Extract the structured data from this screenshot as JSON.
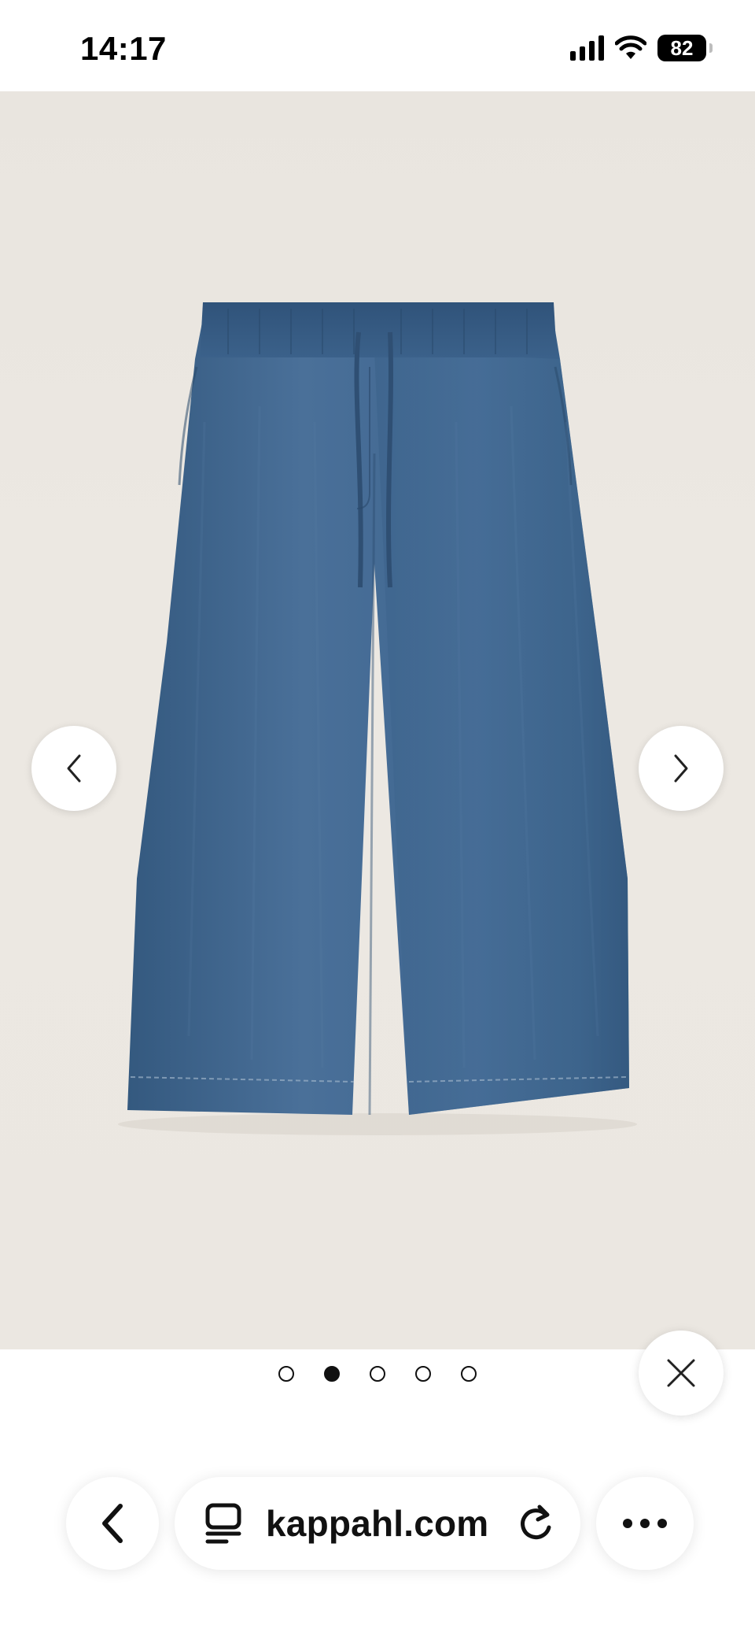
{
  "status_bar": {
    "time": "14:17",
    "battery": "82",
    "icons": [
      "signal-icon",
      "wifi-icon",
      "battery-icon"
    ]
  },
  "gallery": {
    "image_subject": "product-photo",
    "current_index": 2,
    "total": 5,
    "prev_icon": "chevron-left-icon",
    "next_icon": "chevron-right-icon",
    "close_icon": "close-icon"
  },
  "browser": {
    "url": "kappahl.com",
    "back_icon": "back-arrow-icon",
    "tabs_icon": "tab-overview-icon",
    "reload_icon": "reload-icon",
    "more_icon": "more-icon"
  },
  "colors": {
    "background": "#ebe7e1",
    "denim": "#3f6791",
    "denim_dark": "#2d4f74",
    "text": "#111111"
  }
}
